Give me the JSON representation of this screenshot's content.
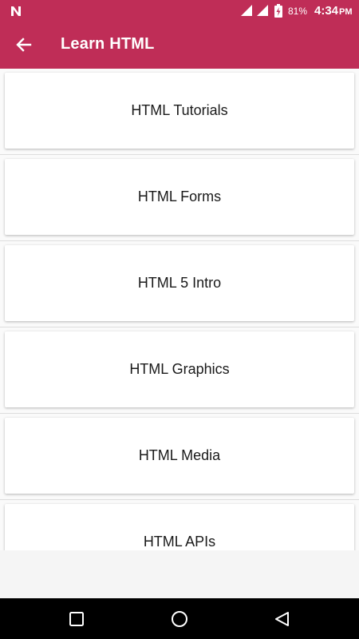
{
  "status_bar": {
    "battery_percent": "81%",
    "time": "4:34",
    "ampm": "PM",
    "icons": [
      "notification-n-icon",
      "wifi-signal-icon",
      "cell-signal-icon",
      "battery-charging-icon"
    ]
  },
  "toolbar": {
    "title": "Learn HTML",
    "back_icon": "arrow-left-icon"
  },
  "items": [
    {
      "label": "HTML Tutorials"
    },
    {
      "label": "HTML Forms"
    },
    {
      "label": "HTML 5 Intro"
    },
    {
      "label": "HTML Graphics"
    },
    {
      "label": "HTML Media"
    },
    {
      "label": "HTML APIs"
    }
  ],
  "nav_bar": {
    "icons": [
      "recents-square-icon",
      "home-circle-icon",
      "back-triangle-icon"
    ]
  },
  "colors": {
    "header": "#bf2d57",
    "nav_bar": "#000000",
    "card": "#ffffff"
  }
}
